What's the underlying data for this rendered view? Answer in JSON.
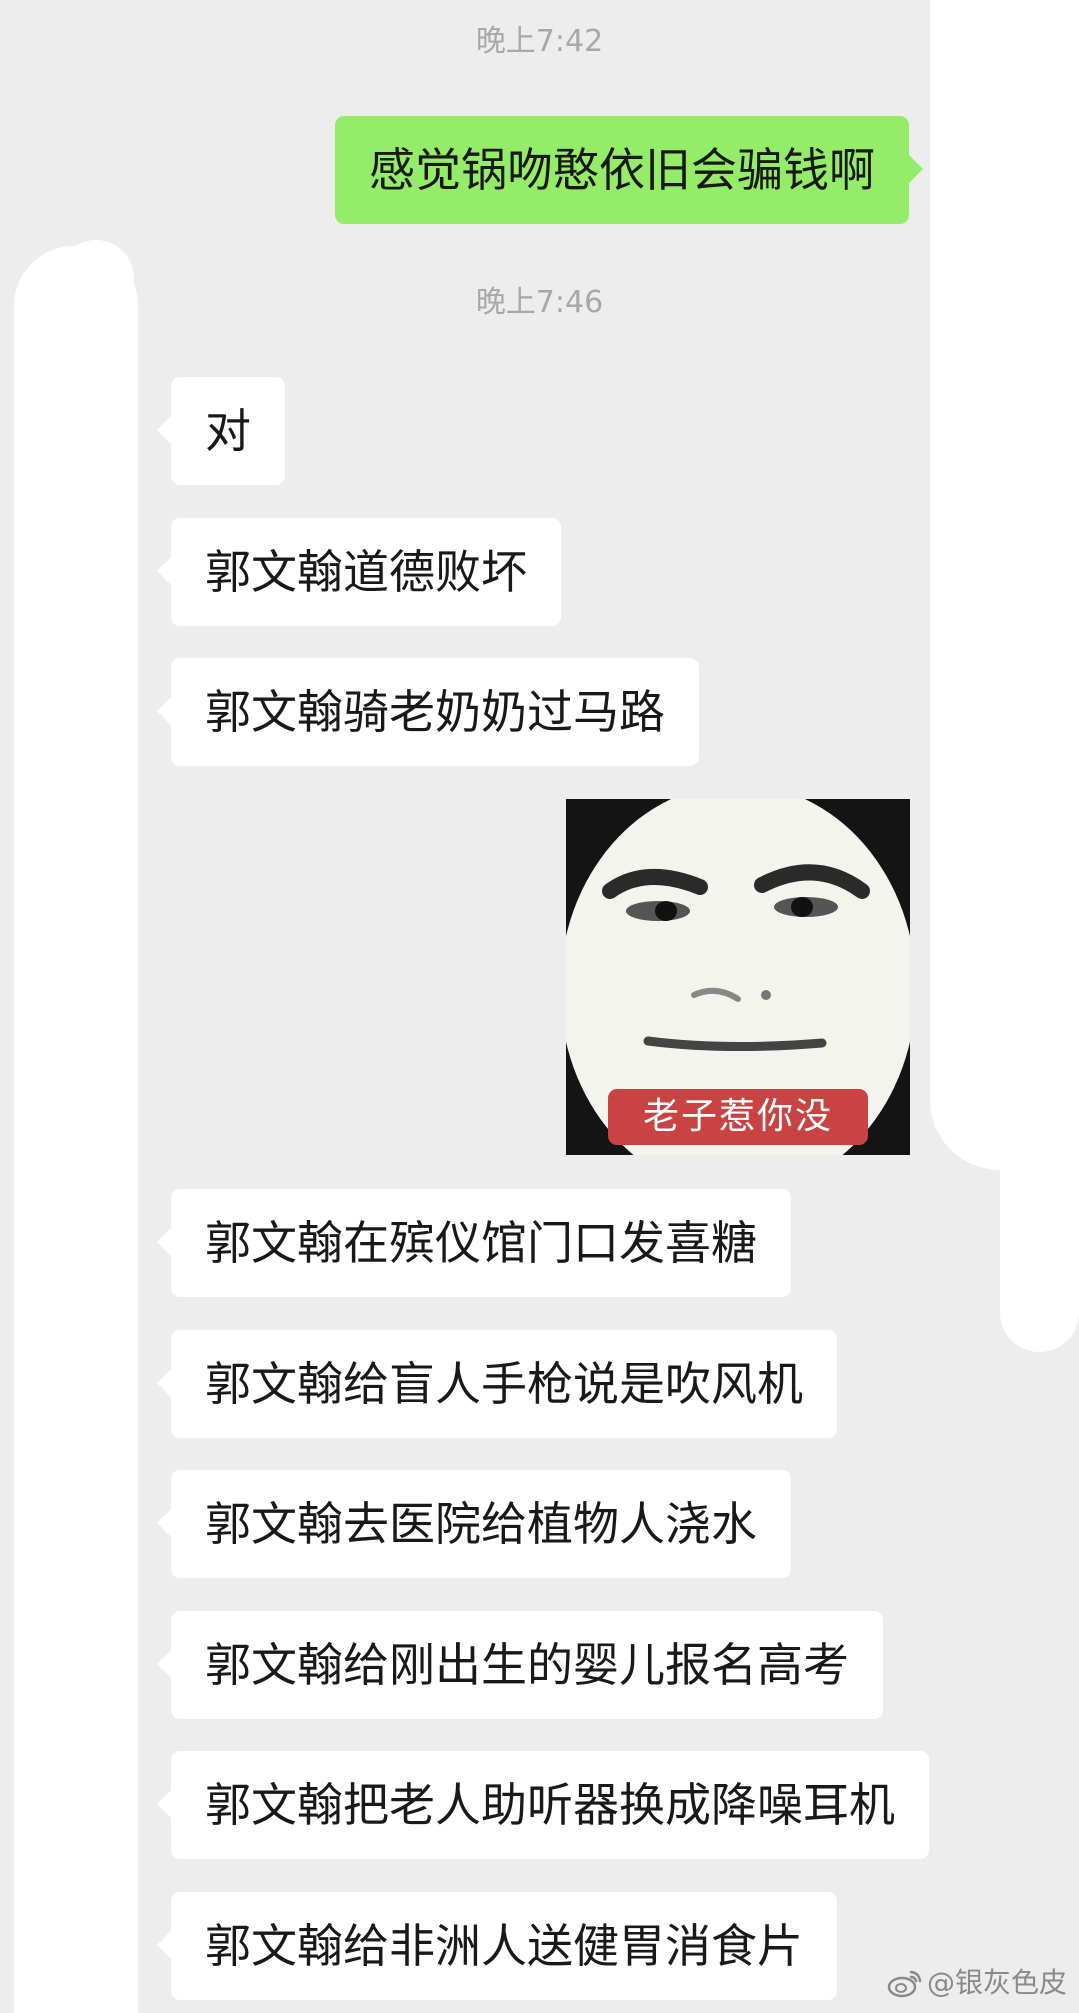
{
  "timestamps": [
    "晚上7:42",
    "晚上7:46"
  ],
  "outgoing": {
    "text": "感觉锅吻憨依旧会骗钱啊"
  },
  "messages_before_sticker": [
    "对",
    "郭文翰道德败坏",
    "郭文翰骑老奶奶过马路"
  ],
  "sticker": {
    "caption": "老子惹你没",
    "icon": "meme-face-sticker"
  },
  "messages_after_sticker": [
    "郭文翰在殡仪馆门口发喜糖",
    "郭文翰给盲人手枪说是吹风机",
    "郭文翰去医院给植物人浇水",
    "郭文翰给刚出生的婴儿报名高考",
    "郭文翰把老人助听器换成降噪耳机",
    "郭文翰给非洲人送健胃消食片"
  ],
  "watermark": {
    "text": "@银灰色皮",
    "icon": "weibo-logo-icon"
  },
  "colors": {
    "background": "#ededed",
    "incoming_bubble": "#ffffff",
    "outgoing_bubble": "#95ec69",
    "timestamp": "#a8a8a8",
    "caption_bg": "#c94343"
  }
}
